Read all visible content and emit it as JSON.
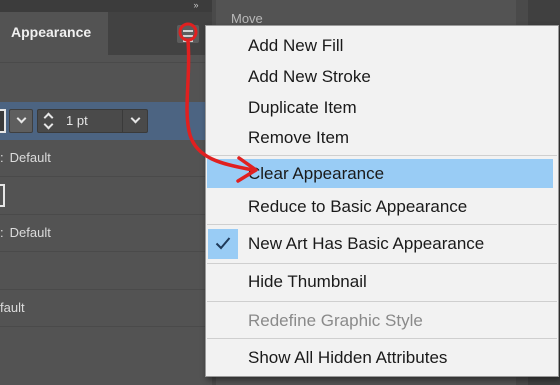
{
  "panel": {
    "title": "Appearance",
    "collapse_icon": "»",
    "stroke_weight": "1 pt",
    "rows": [
      {
        "text": "Default"
      },
      {
        "text": "Default"
      },
      {
        "text": "fault"
      }
    ]
  },
  "background_panel": {
    "title": "Move"
  },
  "menu": {
    "items": [
      {
        "label": "Add New Fill"
      },
      {
        "label": "Add New Stroke"
      },
      {
        "label": "Duplicate Item"
      },
      {
        "label": "Remove Item"
      },
      {
        "label": "Clear Appearance"
      },
      {
        "label": "Reduce to Basic Appearance"
      },
      {
        "label": "New Art Has Basic Appearance"
      },
      {
        "label": "Hide Thumbnail"
      },
      {
        "label": "Redefine Graphic Style"
      },
      {
        "label": "Show All Hidden Attributes"
      }
    ]
  },
  "colors": {
    "highlight": "#99ccf5",
    "annotation_red": "#e02020",
    "panel_bg": "#535353"
  }
}
